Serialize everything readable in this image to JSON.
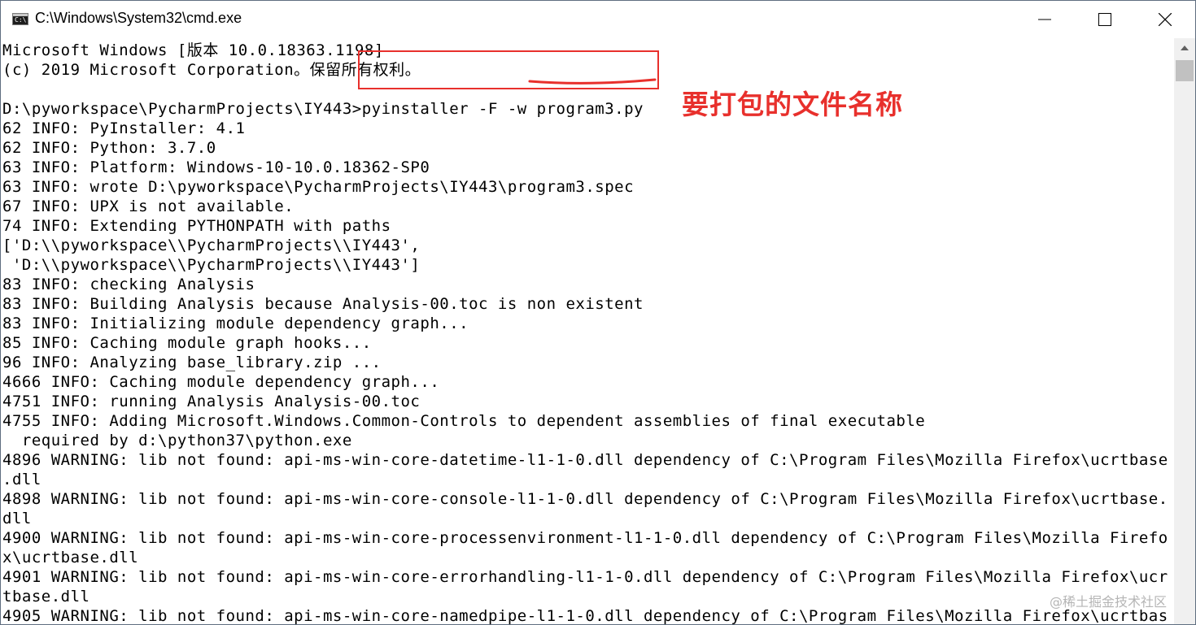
{
  "window": {
    "title": "C:\\Windows\\System32\\cmd.exe",
    "icon": "cmd-icon",
    "icon_text": "C:\\"
  },
  "controls": {
    "minimize_icon": "minimize-icon",
    "maximize_icon": "maximize-icon",
    "close_icon": "close-icon"
  },
  "console": {
    "lines": [
      "Microsoft Windows [版本 10.0.18363.1198]",
      "(c) 2019 Microsoft Corporation。保留所有权利。",
      "",
      "D:\\pyworkspace\\PycharmProjects\\IY443>pyinstaller -F -w program3.py",
      "62 INFO: PyInstaller: 4.1",
      "62 INFO: Python: 3.7.0",
      "63 INFO: Platform: Windows-10-10.0.18362-SP0",
      "63 INFO: wrote D:\\pyworkspace\\PycharmProjects\\IY443\\program3.spec",
      "67 INFO: UPX is not available.",
      "74 INFO: Extending PYTHONPATH with paths",
      "['D:\\\\pyworkspace\\\\PycharmProjects\\\\IY443',",
      " 'D:\\\\pyworkspace\\\\PycharmProjects\\\\IY443']",
      "83 INFO: checking Analysis",
      "83 INFO: Building Analysis because Analysis-00.toc is non existent",
      "83 INFO: Initializing module dependency graph...",
      "85 INFO: Caching module graph hooks...",
      "96 INFO: Analyzing base_library.zip ...",
      "4666 INFO: Caching module dependency graph...",
      "4751 INFO: running Analysis Analysis-00.toc",
      "4755 INFO: Adding Microsoft.Windows.Common-Controls to dependent assemblies of final executable",
      "  required by d:\\python37\\python.exe",
      "4896 WARNING: lib not found: api-ms-win-core-datetime-l1-1-0.dll dependency of C:\\Program Files\\Mozilla Firefox\\ucrtbase",
      ".dll",
      "4898 WARNING: lib not found: api-ms-win-core-console-l1-1-0.dll dependency of C:\\Program Files\\Mozilla Firefox\\ucrtbase.",
      "dll",
      "4900 WARNING: lib not found: api-ms-win-core-processenvironment-l1-1-0.dll dependency of C:\\Program Files\\Mozilla Firefo",
      "x\\ucrtbase.dll",
      "4901 WARNING: lib not found: api-ms-win-core-errorhandling-l1-1-0.dll dependency of C:\\Program Files\\Mozilla Firefox\\ucr",
      "tbase.dll",
      "4905 WARNING: lib not found: api-ms-win-core-namedpipe-l1-1-0.dll dependency of C:\\Program Files\\Mozilla Firefox\\ucrtbas"
    ]
  },
  "annotation": {
    "text": "要打包的文件名称",
    "color": "#e8302c"
  },
  "scrollbar": {
    "up_icon": "scroll-up-arrow-icon"
  },
  "watermark": "@稀土掘金技术社区"
}
